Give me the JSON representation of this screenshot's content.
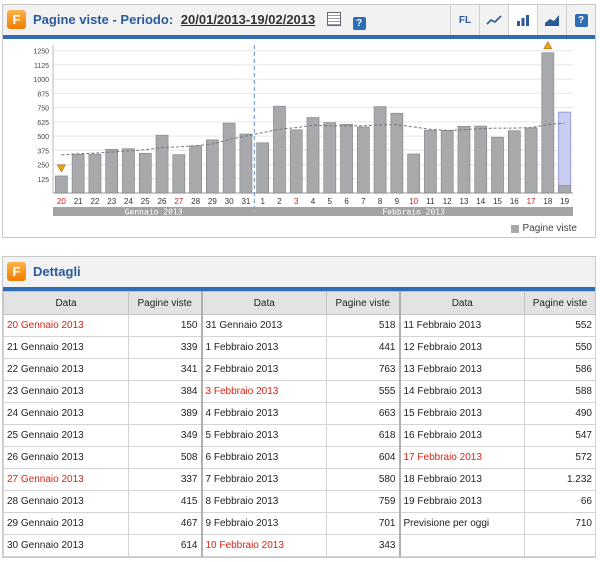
{
  "chart_panel": {
    "title": "Pagine viste - Periodo:",
    "period": "20/01/2013-19/02/2013",
    "tools": {
      "fl_label": "FL",
      "help_label": "?"
    },
    "help_label": "?"
  },
  "chart_data": {
    "type": "bar",
    "categories": [
      "20",
      "21",
      "22",
      "23",
      "24",
      "25",
      "26",
      "27",
      "28",
      "29",
      "30",
      "31",
      "1",
      "2",
      "3",
      "4",
      "5",
      "6",
      "7",
      "8",
      "9",
      "10",
      "11",
      "12",
      "13",
      "14",
      "15",
      "16",
      "17",
      "18",
      "19"
    ],
    "weekend_categories": [
      "20",
      "27",
      "3",
      "10",
      "17"
    ],
    "series": [
      {
        "values": [
          150,
          339,
          341,
          384,
          389,
          349,
          508,
          337,
          415,
          467,
          614,
          518,
          441,
          763,
          555,
          663,
          618,
          604,
          580,
          759,
          701,
          343,
          552,
          550,
          586,
          588,
          490,
          547,
          572,
          1232,
          66
        ]
      },
      {
        "name": "Previsione per oggi",
        "values": [
          null,
          null,
          null,
          null,
          null,
          null,
          null,
          null,
          null,
          null,
          null,
          null,
          null,
          null,
          null,
          null,
          null,
          null,
          null,
          null,
          null,
          null,
          null,
          null,
          null,
          null,
          null,
          null,
          null,
          null,
          710
        ]
      }
    ],
    "trend": [
      335,
      345,
      350,
      360,
      370,
      380,
      400,
      405,
      415,
      430,
      470,
      500,
      530,
      560,
      575,
      595,
      590,
      590,
      590,
      600,
      600,
      580,
      560,
      550,
      555,
      565,
      570,
      570,
      575,
      600,
      615
    ],
    "yticks": [
      125,
      250,
      375,
      500,
      625,
      750,
      875,
      1000,
      1125,
      1250
    ],
    "ylim": [
      0,
      1300
    ],
    "months": [
      "Gennaio 2013",
      "Febbraio 2013"
    ],
    "legend": "Pagine viste",
    "legend_position": "bottom-right",
    "grid": true,
    "colors": {
      "bar": "#a7a9ac",
      "bar_stroke": "#7f8184",
      "forecast": "#c9cdf0",
      "trend": "#777777",
      "weekend": "#d21a1a",
      "month_band": "#a3a3a3",
      "divider": "#5b8fd6"
    }
  },
  "details": {
    "title": "Dettagli",
    "col_data": "Data",
    "col_views": "Pagine viste",
    "columns": [
      [
        {
          "date": "20 Gennaio 2013",
          "views": "150",
          "weekend": true
        },
        {
          "date": "21 Gennaio 2013",
          "views": "339"
        },
        {
          "date": "22 Gennaio 2013",
          "views": "341"
        },
        {
          "date": "23 Gennaio 2013",
          "views": "384"
        },
        {
          "date": "24 Gennaio 2013",
          "views": "389"
        },
        {
          "date": "25 Gennaio 2013",
          "views": "349"
        },
        {
          "date": "26 Gennaio 2013",
          "views": "508"
        },
        {
          "date": "27 Gennaio 2013",
          "views": "337",
          "weekend": true
        },
        {
          "date": "28 Gennaio 2013",
          "views": "415"
        },
        {
          "date": "29 Gennaio 2013",
          "views": "467"
        },
        {
          "date": "30 Gennaio 2013",
          "views": "614"
        }
      ],
      [
        {
          "date": "31 Gennaio 2013",
          "views": "518"
        },
        {
          "date": "1 Febbraio 2013",
          "views": "441"
        },
        {
          "date": "2 Febbraio 2013",
          "views": "763"
        },
        {
          "date": "3 Febbraio 2013",
          "views": "555",
          "weekend": true
        },
        {
          "date": "4 Febbraio 2013",
          "views": "663"
        },
        {
          "date": "5 Febbraio 2013",
          "views": "618"
        },
        {
          "date": "6 Febbraio 2013",
          "views": "604"
        },
        {
          "date": "7 Febbraio 2013",
          "views": "580"
        },
        {
          "date": "8 Febbraio 2013",
          "views": "759"
        },
        {
          "date": "9 Febbraio 2013",
          "views": "701"
        },
        {
          "date": "10 Febbraio 2013",
          "views": "343",
          "weekend": true
        }
      ],
      [
        {
          "date": "11 Febbraio 2013",
          "views": "552"
        },
        {
          "date": "12 Febbraio 2013",
          "views": "550"
        },
        {
          "date": "13 Febbraio 2013",
          "views": "586"
        },
        {
          "date": "14 Febbraio 2013",
          "views": "588"
        },
        {
          "date": "15 Febbraio 2013",
          "views": "490"
        },
        {
          "date": "16 Febbraio 2013",
          "views": "547"
        },
        {
          "date": "17 Febbraio 2013",
          "views": "572",
          "weekend": true
        },
        {
          "date": "18 Febbraio 2013",
          "views": "1.232"
        },
        {
          "date": "19 Febbraio 2013",
          "views": "66"
        },
        {
          "date": "Previsione per oggi",
          "views": "710"
        }
      ]
    ]
  }
}
